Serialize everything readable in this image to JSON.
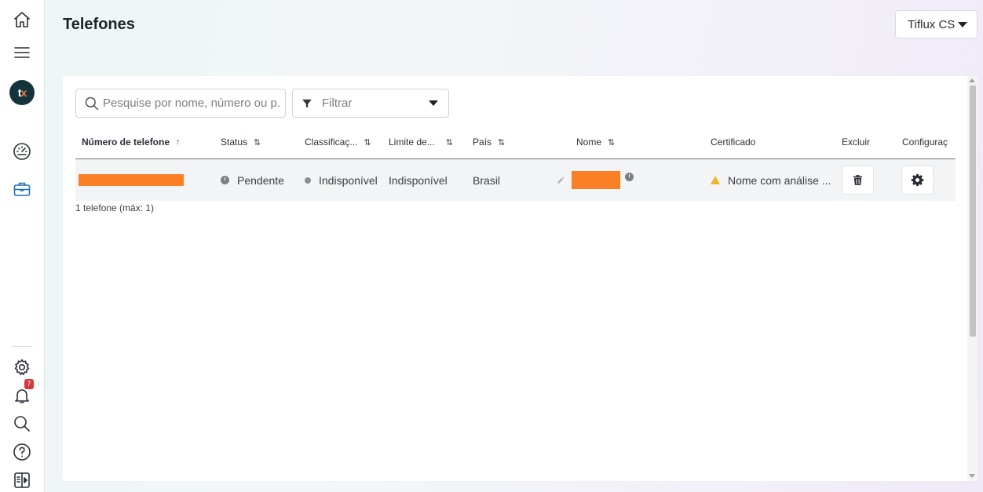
{
  "sidebar": {
    "logo_text_a": "t",
    "logo_text_b": "x",
    "notification_count": "7",
    "icons": [
      "home-icon",
      "menu-icon",
      "dashboard-gauge-icon",
      "briefcase-icon",
      "gear-icon",
      "bell-icon",
      "search-icon",
      "help-icon",
      "panel-toggle-icon"
    ]
  },
  "header": {
    "title": "Telefones",
    "company_select": "Tiflux CS"
  },
  "toolbar": {
    "search_placeholder": "Pesquise por nome, número ou p...",
    "filter_label": "Filtrar"
  },
  "table": {
    "columns": [
      {
        "label": "Número de telefone",
        "sort": "↑"
      },
      {
        "label": "Status",
        "sort": "⇅"
      },
      {
        "label": "Classificaç...",
        "sort": "⇅"
      },
      {
        "label": "Limite de...",
        "sort": "⇅"
      },
      {
        "label": "País",
        "sort": "⇅"
      },
      {
        "label": "Nome",
        "sort": "⇅"
      },
      {
        "label": "Certificado",
        "sort": ""
      },
      {
        "label": "Excluir",
        "sort": ""
      },
      {
        "label": "Configuraç",
        "sort": ""
      }
    ],
    "rows": [
      {
        "status": "Pendente",
        "classification": "Indisponível",
        "limit": "Indisponível",
        "country": "Brasil",
        "certificate": "Nome com análise ..."
      }
    ],
    "footer": "1 telefone (máx: 1)"
  },
  "colors": {
    "redaction": "#fb7f24",
    "warning": "#f0b429",
    "badge": "#d9363e",
    "logo_bg": "#13343b"
  }
}
